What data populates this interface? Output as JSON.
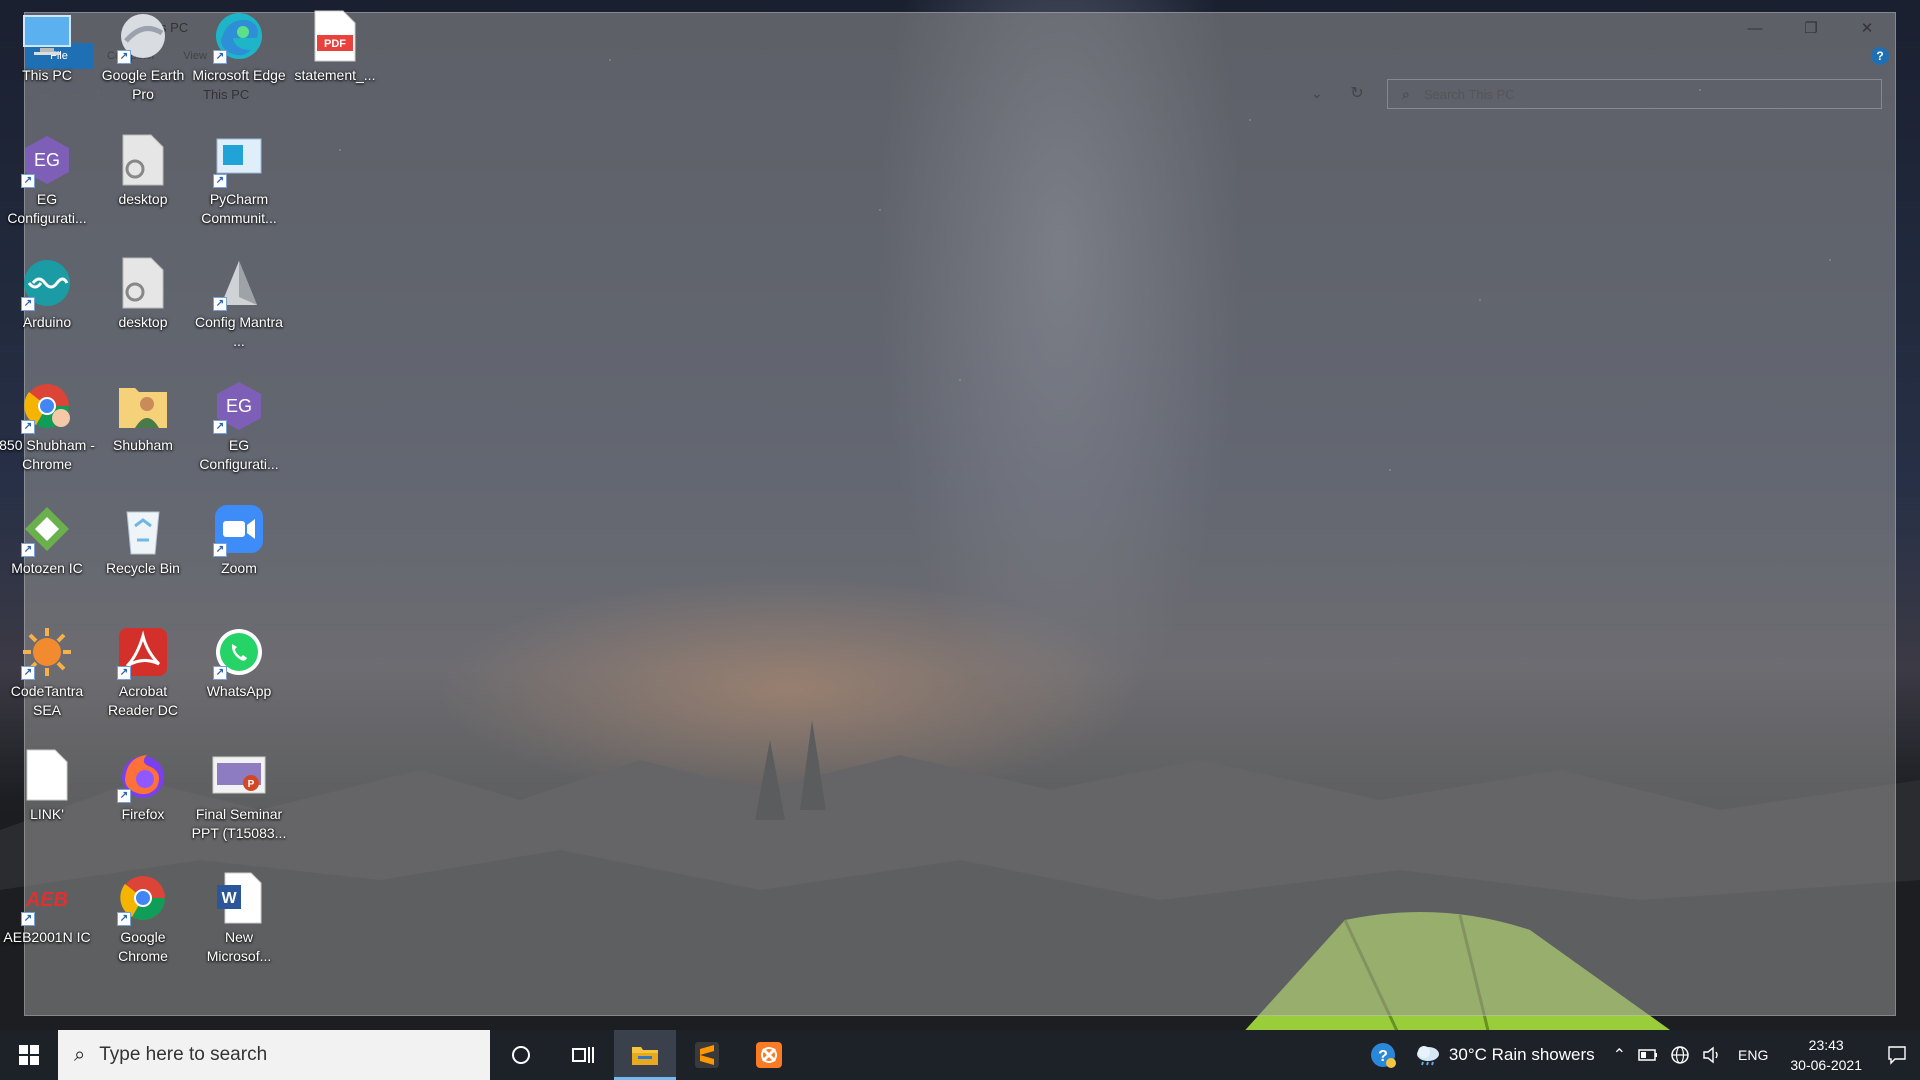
{
  "explorer": {
    "title": "This PC",
    "tabs": [
      "File",
      "Computer",
      "View"
    ],
    "breadcrumb": "This PC",
    "search_placeholder": "Search This PC",
    "controls": {
      "minimize": "—",
      "restore": "❐",
      "close": "✕"
    },
    "help": "?"
  },
  "desktop": {
    "icons": [
      {
        "label": "This PC",
        "icon": "this-pc-icon",
        "shortcut": false
      },
      {
        "label": "Google Earth Pro",
        "icon": "google-earth-icon",
        "shortcut": true
      },
      {
        "label": "Microsoft Edge",
        "icon": "edge-icon",
        "shortcut": true
      },
      {
        "label": "statement_...",
        "icon": "pdf-file-icon",
        "shortcut": false,
        "badge": "PDF"
      },
      {
        "label": "EG Configurati...",
        "icon": "eg-config-icon",
        "shortcut": true,
        "badge": "EG"
      },
      {
        "label": "desktop",
        "icon": "settings-file-icon",
        "shortcut": false
      },
      {
        "label": "PyCharm Communit...",
        "icon": "pycharm-icon",
        "shortcut": true
      },
      {
        "label": "Arduino",
        "icon": "arduino-icon",
        "shortcut": true
      },
      {
        "label": "desktop",
        "icon": "settings-file-icon",
        "shortcut": false
      },
      {
        "label": "Config Mantra ...",
        "icon": "config-mantra-icon",
        "shortcut": true
      },
      {
        "label": "850 Shubham - Chrome",
        "icon": "chrome-profile-icon",
        "shortcut": true
      },
      {
        "label": "Shubham",
        "icon": "user-folder-icon",
        "shortcut": false
      },
      {
        "label": "EG Configurati...",
        "icon": "eg-config-icon",
        "shortcut": true,
        "badge": "EG"
      },
      {
        "label": "Motozen IC",
        "icon": "motozen-icon",
        "shortcut": true
      },
      {
        "label": "Recycle Bin",
        "icon": "recycle-bin-icon",
        "shortcut": false
      },
      {
        "label": "Zoom",
        "icon": "zoom-icon",
        "shortcut": true
      },
      {
        "label": "CodeTantra SEA",
        "icon": "codetantra-icon",
        "shortcut": true
      },
      {
        "label": "Acrobat Reader DC",
        "icon": "acrobat-icon",
        "shortcut": true
      },
      {
        "label": "WhatsApp",
        "icon": "whatsapp-icon",
        "shortcut": true
      },
      {
        "label": "LINK'",
        "icon": "blank-file-icon",
        "shortcut": false
      },
      {
        "label": "Firefox",
        "icon": "firefox-icon",
        "shortcut": true
      },
      {
        "label": "Final Seminar PPT (T15083...",
        "icon": "ppt-file-icon",
        "shortcut": false
      },
      {
        "label": "AEB2001N IC",
        "icon": "aeb-icon",
        "shortcut": true,
        "badge": "AEB"
      },
      {
        "label": "Google Chrome",
        "icon": "chrome-icon",
        "shortcut": true
      },
      {
        "label": "New Microsof...",
        "icon": "word-file-icon",
        "shortcut": false,
        "badge": "W"
      }
    ]
  },
  "taskbar": {
    "search_placeholder": "Type here to search",
    "weather": "30°C  Rain showers",
    "language": "ENG",
    "time": "23:43",
    "date": "30-06-2021"
  },
  "colors": {
    "taskbar_bg": "#1d2128",
    "accent": "#1f6fb4",
    "active_indicator": "#76b9ed"
  }
}
